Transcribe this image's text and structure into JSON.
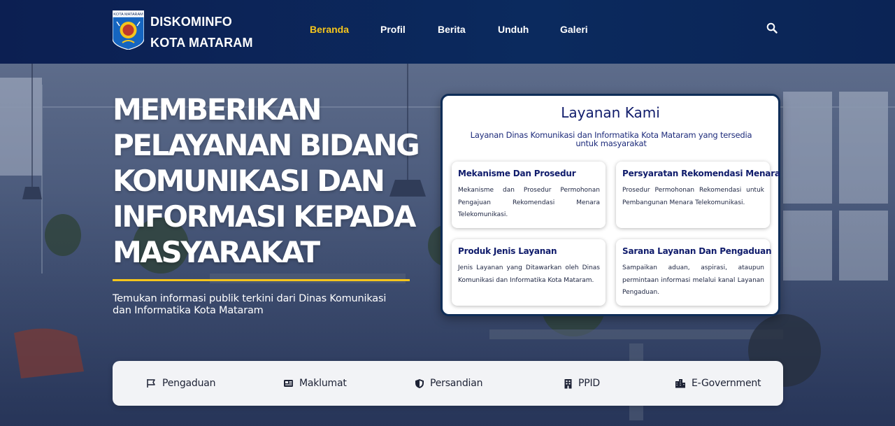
{
  "brand": {
    "line1": "DISKOMINFO",
    "line2": "KOTA MATARAM",
    "logo_text": "KOTA MATARAM"
  },
  "nav": {
    "items": [
      {
        "label": "Beranda",
        "active": true
      },
      {
        "label": "Profil",
        "active": false
      },
      {
        "label": "Berita",
        "active": false
      },
      {
        "label": "Unduh",
        "active": false
      },
      {
        "label": "Galeri",
        "active": false
      }
    ],
    "search_icon": "search-icon"
  },
  "hero": {
    "headline": "MEMBERIKAN PELAYANAN BIDANG KOMUNIKASI DAN INFORMASI KEPADA MASYARAKAT",
    "subheadline": "Temukan informasi publik terkini dari Dinas Komunikasi dan Informatika Kota Mataram"
  },
  "services": {
    "title": "Layanan Kami",
    "subtitle": "Layanan Dinas Komunikasi dan Informatika Kota Mataram yang tersedia untuk masyarakat",
    "cards": [
      {
        "title": "Mekanisme Dan Prosedur",
        "description": "Mekanisme dan Prosedur Permohonan Pengajuan Rekomendasi Menara Telekomunikasi."
      },
      {
        "title": "Persyaratan Rekomendasi Menara",
        "description": "Prosedur Permohonan Rekomendasi untuk Pembangunan Menara Telekomunikasi."
      },
      {
        "title": "Produk Jenis Layanan",
        "description": "Jenis Layanan yang Ditawarkan oleh Dinas Komunikasi dan Informatika Kota Mataram."
      },
      {
        "title": "Sarana Layanan Dan Pengaduan",
        "description": "Sampaikan aduan, aspirasi, ataupun permintaan informasi melalui kanal Layanan Pengaduan."
      }
    ]
  },
  "quick_links": [
    {
      "label": "Pengaduan",
      "icon": "flag-icon"
    },
    {
      "label": "Maklumat",
      "icon": "newspaper-icon"
    },
    {
      "label": "Persandian",
      "icon": "shield-icon"
    },
    {
      "label": "PPID",
      "icon": "building-icon"
    },
    {
      "label": "E-Government",
      "icon": "city-icon"
    }
  ],
  "colors": {
    "header_bg": "#0b2a5e",
    "accent": "#f5c51c",
    "card_title": "#0f1b6b",
    "quickbar_bg": "#f2f3f6"
  }
}
